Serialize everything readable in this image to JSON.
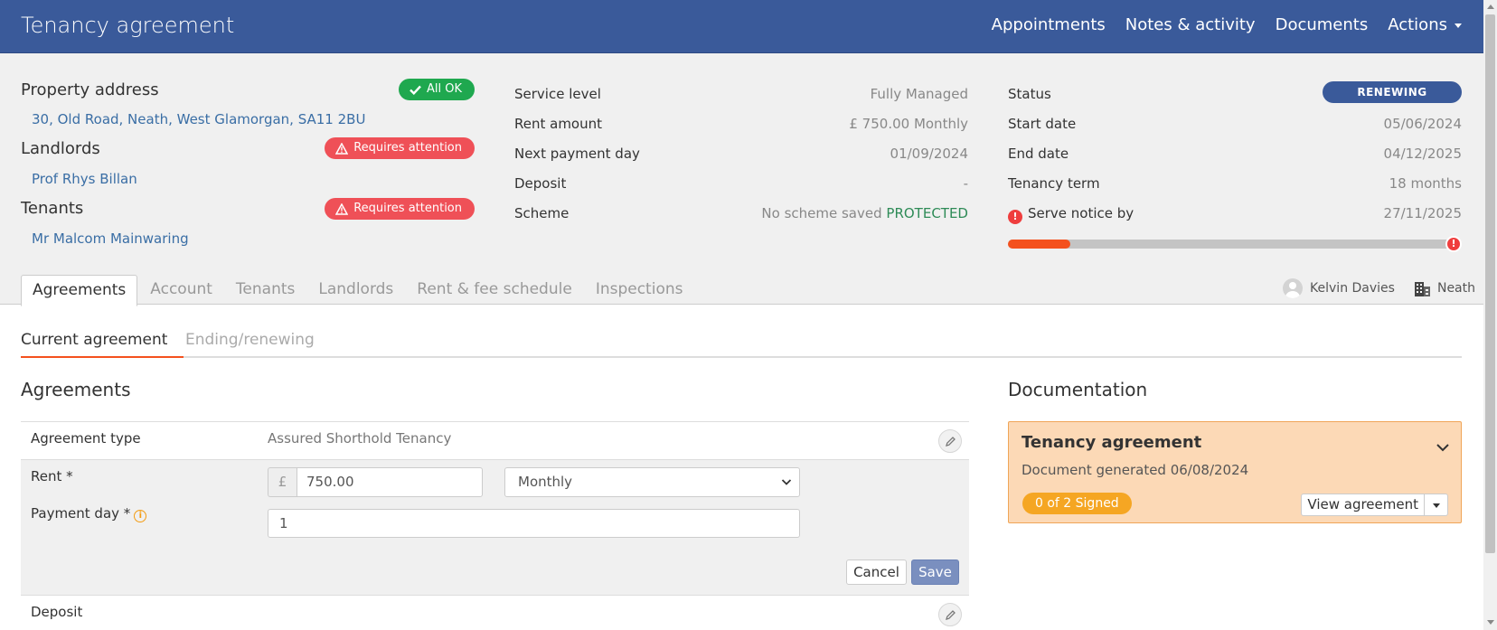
{
  "header": {
    "title": "Tenancy agreement",
    "nav": [
      "Appointments",
      "Notes & activity",
      "Documents",
      "Actions"
    ]
  },
  "summary": {
    "property": {
      "title": "Property address",
      "badge": "All OK",
      "link": "30, Old Road, Neath, West Glamorgan, SA11 2BU"
    },
    "landlords": {
      "title": "Landlords",
      "badge": "Requires attention",
      "link": "Prof Rhys Billan"
    },
    "tenants": {
      "title": "Tenants",
      "badge": "Requires attention",
      "link": "Mr Malcom Mainwaring"
    },
    "details": [
      {
        "label": "Service level",
        "value": "Fully Managed"
      },
      {
        "label": "Rent amount",
        "value": "£ 750.00 Monthly"
      },
      {
        "label": "Next payment day",
        "value": "01/09/2024"
      },
      {
        "label": "Deposit",
        "value": "-"
      },
      {
        "label": "Scheme",
        "value": "No scheme saved",
        "extra": "PROTECTED"
      }
    ],
    "status": {
      "label": "Status",
      "value": "RENEWING",
      "rows": [
        {
          "label": "Start date",
          "value": "05/06/2024"
        },
        {
          "label": "End date",
          "value": "04/12/2025"
        },
        {
          "label": "Tenancy term",
          "value": "18 months"
        },
        {
          "label": "Serve notice by",
          "value": "27/11/2025"
        }
      ],
      "progress": 0.14
    }
  },
  "tabs": [
    "Agreements",
    "Account",
    "Tenants",
    "Landlords",
    "Rent & fee schedule",
    "Inspections"
  ],
  "assignees": {
    "user": "Kelvin Davies",
    "office": "Neath"
  },
  "subtabs": [
    "Current agreement",
    "Ending/renewing"
  ],
  "agreements": {
    "heading": "Agreements",
    "type_label": "Agreement type",
    "type_value": "Assured Shorthold Tenancy",
    "rent_label": "Rent *",
    "currency": "£",
    "rent_value": "750.00",
    "frequency": "Monthly",
    "payment_day_label": "Payment day *",
    "payment_day_value": "1",
    "cancel": "Cancel",
    "save": "Save",
    "deposit_label": "Deposit"
  },
  "documentation": {
    "heading": "Documentation",
    "card_title": "Tenancy agreement",
    "card_sub": "Document generated 06/08/2024",
    "signed": "0 of 2 Signed",
    "view": "View agreement"
  },
  "colors": {
    "header": "#3a5a9a",
    "ok": "#1fa84f",
    "warn": "#ef5057",
    "accent": "#f4511e",
    "doc_card": "#fcd9b6"
  }
}
